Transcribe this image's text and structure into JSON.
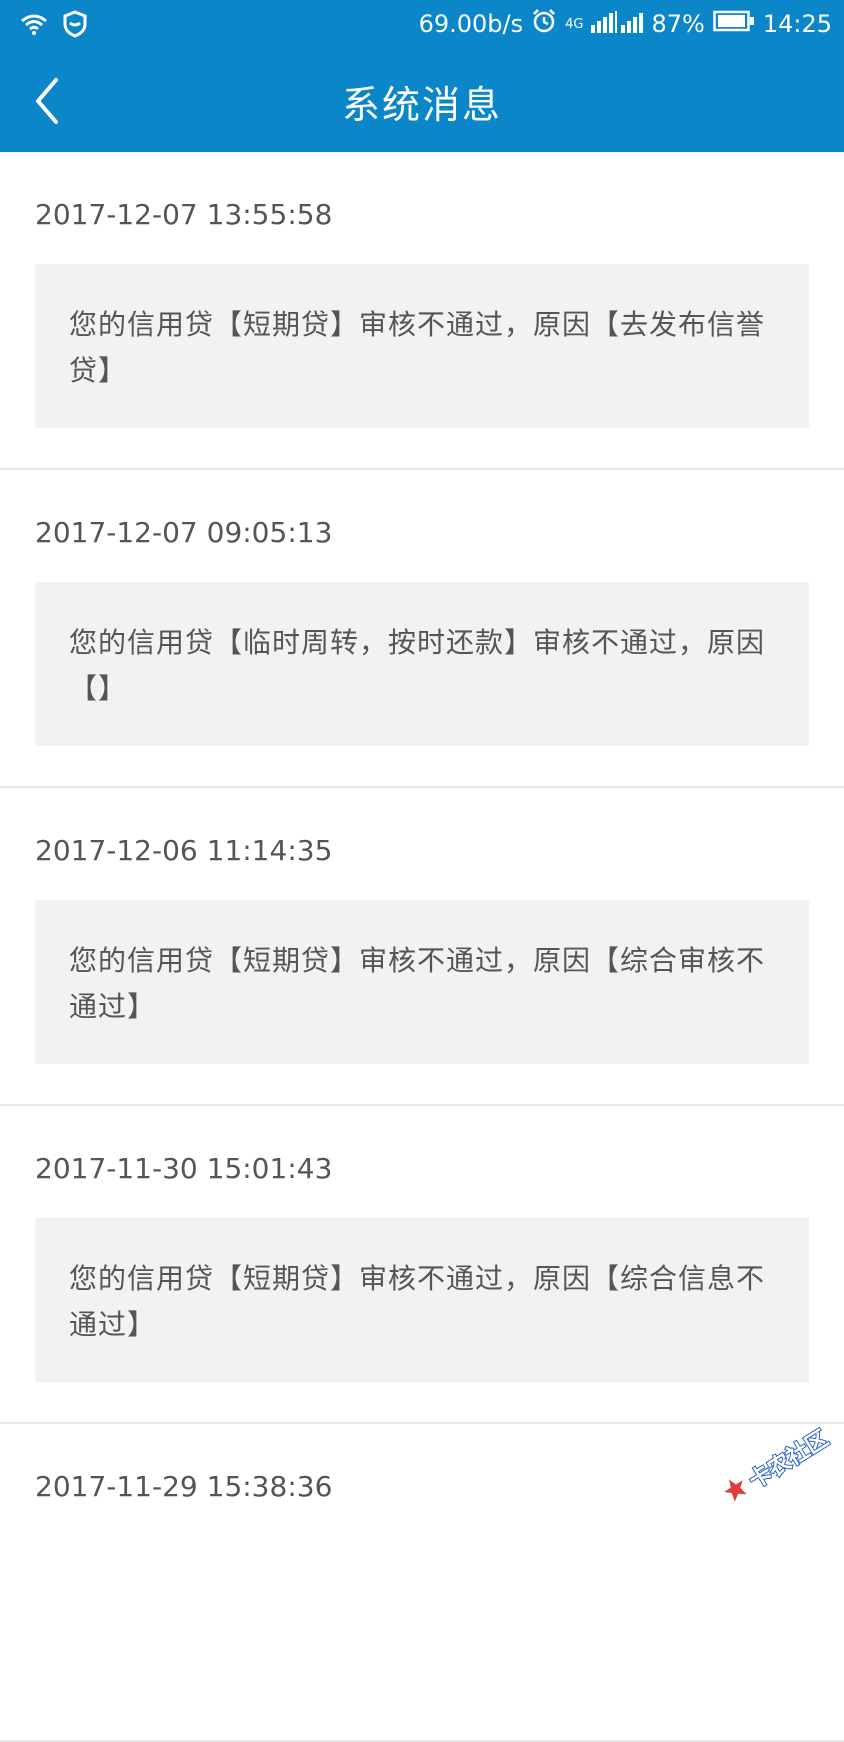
{
  "status_bar": {
    "speed": "69.00b/s",
    "network": "4G",
    "battery": "87%",
    "time": "14:25",
    "icons": [
      "wifi-icon",
      "shield-icon",
      "alarm-icon",
      "signal-icon",
      "battery-icon"
    ]
  },
  "header": {
    "title": "系统消息",
    "back_icon": "chevron-left-icon",
    "background": "#0a86c9"
  },
  "messages": [
    {
      "time": "2017-12-07 13:55:58",
      "text": "您的信用贷【短期贷】审核不通过，原因【去发布信誉贷】"
    },
    {
      "time": "2017-12-07 09:05:13",
      "text": "您的信用贷【临时周转，按时还款】审核不通过，原因【】"
    },
    {
      "time": "2017-12-06 11:14:35",
      "text": "您的信用贷【短期贷】审核不通过，原因【综合审核不通过】"
    },
    {
      "time": "2017-11-30 15:01:43",
      "text": "您的信用贷【短期贷】审核不通过，原因【综合信息不通过】"
    },
    {
      "time": "2017-11-29 15:38:36",
      "text": ""
    }
  ],
  "watermark": {
    "text": "卡农社区"
  }
}
